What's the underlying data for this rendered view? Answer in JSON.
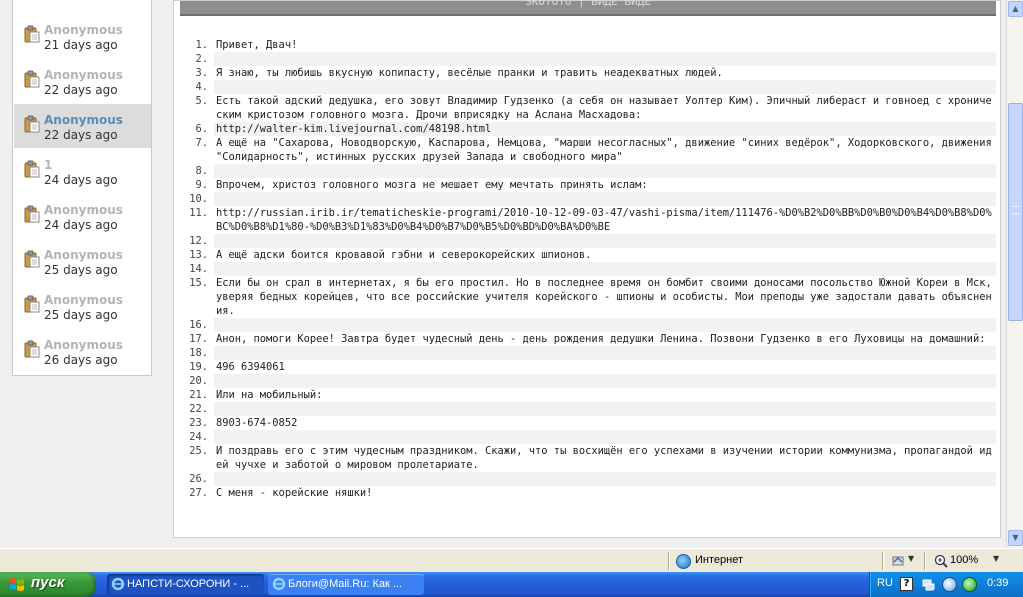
{
  "sidebar": {
    "items": [
      {
        "name": "Anonymous",
        "date": "21 days ago",
        "active": false
      },
      {
        "name": "Anonymous",
        "date": "22 days ago",
        "active": false
      },
      {
        "name": "Anonymous",
        "date": "22 days ago",
        "active": true
      },
      {
        "name": "1",
        "date": "24 days ago",
        "active": false
      },
      {
        "name": "Anonymous",
        "date": "24 days ago",
        "active": false
      },
      {
        "name": "Anonymous",
        "date": "25 days ago",
        "active": false
      },
      {
        "name": "Anonymous",
        "date": "25 days ago",
        "active": false
      },
      {
        "name": "Anonymous",
        "date": "26 days ago",
        "active": false
      }
    ]
  },
  "code": {
    "header": "SKOTOTO | ВИДЕ ВИДЕ",
    "lines": [
      {
        "n": "1.",
        "t": "Привет, Двач!"
      },
      {
        "n": "2.",
        "t": ""
      },
      {
        "n": "3.",
        "t": "Я знаю, ты любишь вкусную копипасту, весёлые пранки и травить неадекватных людей."
      },
      {
        "n": "4.",
        "t": ""
      },
      {
        "n": "5.",
        "t": "Есть такой адский дедушка, его зовут Владимир Гудзенко (а себя он называет Уолтер Ким). Эпичный либераст и говноед с хроническим кристозом головного мозга. Дрочи вприсядку на Аслана Масхадова:"
      },
      {
        "n": "6.",
        "t": "http://walter-kim.livejournal.com/48198.html"
      },
      {
        "n": "7.",
        "t": "А ещё на \"Сахарова, Новодворскую, Каспарова, Немцова, \"марши несогласных\", движение \"синих ведёрок\", Ходорковского, движения \"Солидарность\", истинных русских друзей Запада и свободного мира\""
      },
      {
        "n": "8.",
        "t": ""
      },
      {
        "n": "9.",
        "t": "Впрочем, христоз головного мозга не мешает ему мечтать принять ислам:"
      },
      {
        "n": "10.",
        "t": ""
      },
      {
        "n": "11.",
        "t": "http://russian.irib.ir/tematicheskie-programi/2010-10-12-09-03-47/vashi-pisma/item/111476-%D0%B2%D0%BB%D0%B0%D0%B4%D0%B8%D0%BC%D0%B8%D1%80-%D0%B3%D1%83%D0%B4%D0%B7%D0%B5%D0%BD%D0%BA%D0%BE"
      },
      {
        "n": "12.",
        "t": ""
      },
      {
        "n": "13.",
        "t": "А ещё адски боится кровавой гэбни и северокорейских шпионов."
      },
      {
        "n": "14.",
        "t": ""
      },
      {
        "n": "15.",
        "t": "Если бы он срал в интернетах, я бы его простил. Но в последнее время он бомбит своими доносами посольство Южной Кореи в Мск, уверяя бедных корейцев, что все российские учителя корейского - шпионы и особисты. Мои преподы уже задостали давать объяснения."
      },
      {
        "n": "16.",
        "t": ""
      },
      {
        "n": "17.",
        "t": "Анон, помоги Корее! Завтра будет чудесный день - день рождения дедушки Ленина. Позвони Гудзенко в его Луховицы на домашний:"
      },
      {
        "n": "18.",
        "t": ""
      },
      {
        "n": "19.",
        "t": "496 6394061"
      },
      {
        "n": "20.",
        "t": ""
      },
      {
        "n": "21.",
        "t": "Или на мобильный:"
      },
      {
        "n": "22.",
        "t": ""
      },
      {
        "n": "23.",
        "t": "8903-674-0852"
      },
      {
        "n": "24.",
        "t": ""
      },
      {
        "n": "25.",
        "t": "И поздравь его с этим чудесным праздником. Скажи, что ты восхищён его успехами в изучении истории коммунизма, пропагандой идей чучхе и заботой о мировом пролетариате."
      },
      {
        "n": "26.",
        "t": ""
      },
      {
        "n": "27.",
        "t": "С меня - корейские няшки!"
      }
    ]
  },
  "statusbar": {
    "zone": "Интернет",
    "zoom": "100%"
  },
  "taskbar": {
    "start": "пуск",
    "tasks": [
      {
        "label": "НАПСТИ-СХОРОНИ - ...",
        "active": true
      },
      {
        "label": "Блоги@Mail.Ru: Как ...",
        "active": false
      }
    ],
    "lang": "RU",
    "clock": "0:39"
  },
  "colors": {
    "taskbar": "#245edb",
    "start_button": "#3a9a3a",
    "active_item_name": "#5b8cb4",
    "inactive_item_name": "#b4b4b4"
  }
}
